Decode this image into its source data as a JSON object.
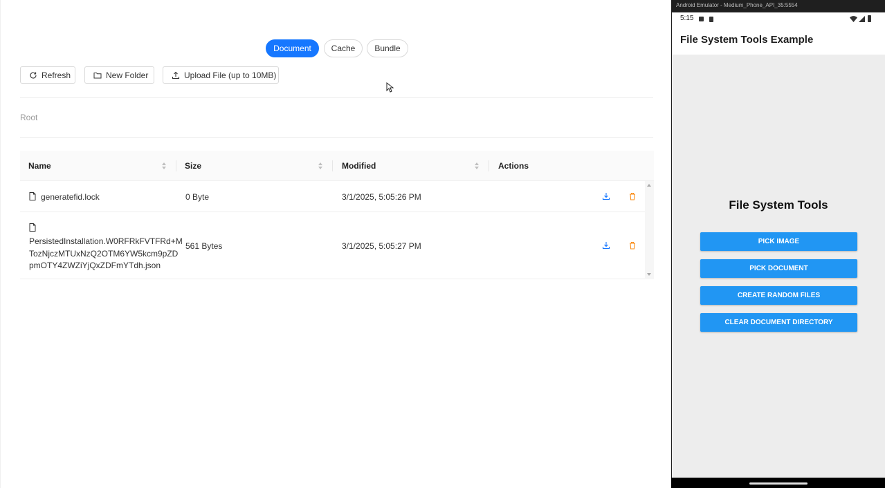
{
  "web": {
    "segments": [
      {
        "label": "Document",
        "active": true
      },
      {
        "label": "Cache",
        "active": false
      },
      {
        "label": "Bundle",
        "active": false
      }
    ],
    "toolbar": {
      "refresh_label": "Refresh",
      "new_folder_label": "New Folder",
      "upload_label": "Upload File (up to 10MB)"
    },
    "breadcrumb": "Root",
    "table": {
      "headers": {
        "name": "Name",
        "size": "Size",
        "modified": "Modified",
        "actions": "Actions"
      },
      "rows": [
        {
          "name": "generatefid.lock",
          "size": "0 Byte",
          "modified": "3/1/2025, 5:05:26 PM"
        },
        {
          "name_lines": [
            "PersistedInstallation.W0RFRkFVTFRd+M",
            "TozNjczMTUxNzQ2OTM6YW5kcm9pZD",
            "pmOTY4ZWZiYjQxZDFmYTdh.json"
          ],
          "size": "561 Bytes",
          "modified": "3/1/2025, 5:05:27 PM"
        }
      ]
    },
    "colors": {
      "primary": "#1677ff",
      "download": "#1677ff",
      "delete": "#fa8c16"
    }
  },
  "emulator": {
    "window_title": "Android Emulator - Medium_Phone_API_35:5554",
    "status_time": "5:15",
    "app_title": "File System Tools Example",
    "heading": "File System Tools",
    "buttons": [
      "PICK IMAGE",
      "PICK DOCUMENT",
      "CREATE RANDOM FILES",
      "CLEAR DOCUMENT DIRECTORY"
    ],
    "colors": {
      "button": "#2196f3"
    }
  }
}
